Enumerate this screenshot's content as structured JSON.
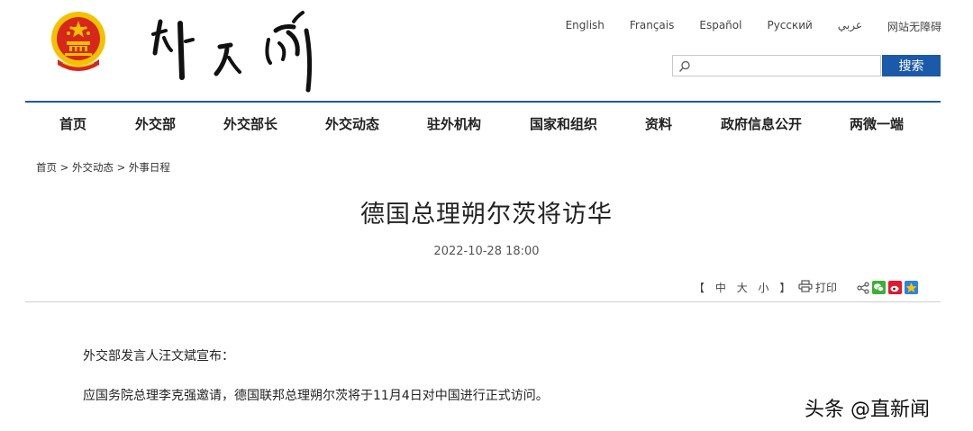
{
  "header": {
    "languages": [
      "English",
      "Français",
      "Español",
      "Русский",
      "عربي",
      "网站无障碍"
    ],
    "search": {
      "placeholder": "",
      "button_label": "搜索"
    }
  },
  "nav": {
    "items": [
      "首页",
      "外交部",
      "外交部长",
      "外交动态",
      "驻外机构",
      "国家和组织",
      "资料",
      "政府信息公开",
      "两微一端"
    ]
  },
  "breadcrumb": {
    "items": [
      "首页",
      "外交动态",
      "外事日程"
    ],
    "separator": ">"
  },
  "article": {
    "title": "德国总理朔尔茨将访华",
    "date": "2022-10-28 18:00",
    "font_size_open": "【",
    "font_size_labels": [
      "中",
      "大",
      "小"
    ],
    "font_size_close": "】",
    "print_label": "打印",
    "paragraphs": [
      "外交部发言人汪文斌宣布：",
      "应国务院总理李克强邀请，德国联邦总理朔尔茨将于11月4日对中国进行正式访问。"
    ]
  },
  "watermark": "头条 @直新闻",
  "colors": {
    "brand_blue": "#1a5aa8",
    "emblem_red": "#d7261b",
    "emblem_gold": "#f2c200"
  }
}
